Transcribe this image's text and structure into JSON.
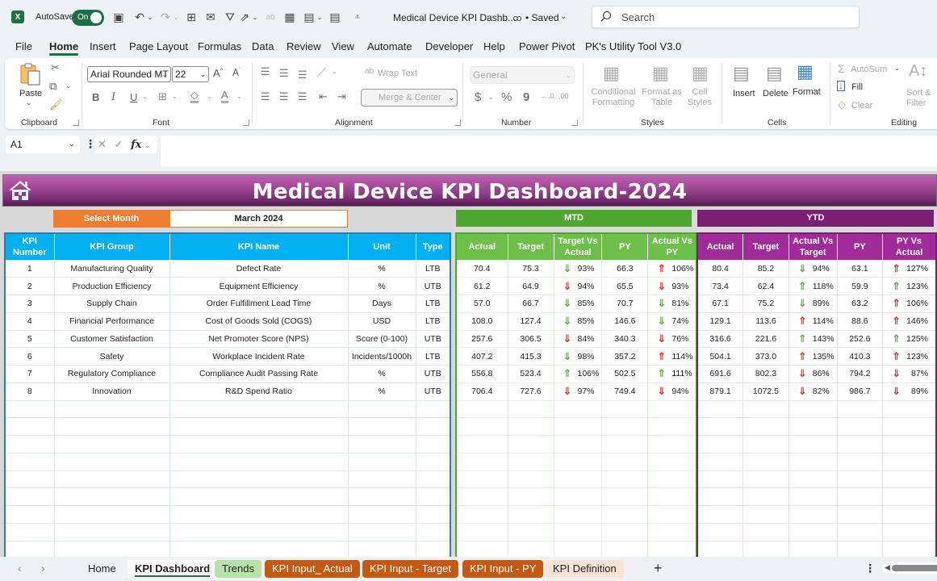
{
  "titlebar": {
    "autosave_label": "AutoSave",
    "autosave_state": "On",
    "document_title": "Medical Device KPI Dashb...",
    "save_status": "• Saved",
    "search_placeholder": "Search"
  },
  "menu": {
    "tabs": [
      "File",
      "Home",
      "Insert",
      "Page Layout",
      "Formulas",
      "Data",
      "Review",
      "View",
      "Automate",
      "Developer",
      "Help",
      "Power Pivot",
      "PK's Utility Tool V3.0"
    ],
    "active": "Home"
  },
  "ribbon": {
    "clipboard": {
      "label": "Clipboard",
      "paste": "Paste"
    },
    "font": {
      "label": "Font",
      "font_name": "Arial Rounded MT",
      "font_size": "22",
      "bold": "B",
      "italic": "I",
      "underline": "U"
    },
    "alignment": {
      "label": "Alignment",
      "wrap_text": "Wrap Text",
      "merge_center": "Merge & Center"
    },
    "number": {
      "label": "Number",
      "format": "General",
      "currency": "$",
      "percent": "%",
      "comma": "9"
    },
    "styles": {
      "label": "Styles",
      "conditional": "Conditional Formatting",
      "format_table": "Format as Table",
      "cell_styles": "Cell Styles"
    },
    "cells": {
      "label": "Cells",
      "insert": "Insert",
      "delete": "Delete",
      "format": "Format"
    },
    "editing": {
      "label": "Editing",
      "autosum": "AutoSum",
      "fill": "Fill",
      "clear": "Clear",
      "sort_filter": "Sort & Filter"
    }
  },
  "formula_bar": {
    "name_box": "A1",
    "fx": "fx",
    "value": ""
  },
  "dashboard": {
    "title": "Medical Device KPI Dashboard-2024",
    "select_month_label": "Select Month",
    "selected_month": "March 2024",
    "mtd_label": "MTD",
    "ytd_label": "YTD",
    "colors": {
      "banner": "#8d3d85",
      "select": "#ed7d31",
      "kpi_header": "#00b0f0",
      "mtd": "#4ea72e",
      "ytd": "#7b1f75",
      "arrow_good": "#4ea72e",
      "arrow_bad": "#e02020"
    },
    "kpi_headers": [
      "KPI Number",
      "KPI Group",
      "KPI Name",
      "Unit",
      "Type"
    ],
    "mtd_headers": [
      "Actual",
      "Target",
      "Target Vs Actual",
      "PY",
      "Actual Vs PY"
    ],
    "ytd_headers": [
      "Actual",
      "Target",
      "Actual Vs Target",
      "PY",
      "PY Vs Actual"
    ],
    "rows": [
      {
        "num": "1",
        "group": "Manufacturing Quality",
        "name": "Defect Rate",
        "unit": "%",
        "type": "LTB",
        "mtd": {
          "actual": "70.4",
          "target": "75.3",
          "tva": "93%",
          "tva_dir": "down",
          "tva_color": "green",
          "py": "66.3",
          "avp": "106%",
          "avp_dir": "up",
          "avp_color": "red"
        },
        "ytd": {
          "actual": "80.4",
          "target": "85.2",
          "avt": "94%",
          "avt_dir": "down",
          "avt_color": "green",
          "py": "63.1",
          "pva": "127%",
          "pva_dir": "up",
          "pva_color": "red"
        }
      },
      {
        "num": "2",
        "group": "Production Efficiency",
        "name": "Equipment Efficiency",
        "unit": "%",
        "type": "UTB",
        "mtd": {
          "actual": "61.2",
          "target": "64.9",
          "tva": "94%",
          "tva_dir": "down",
          "tva_color": "red",
          "py": "65.5",
          "avp": "93%",
          "avp_dir": "down",
          "avp_color": "red"
        },
        "ytd": {
          "actual": "73.4",
          "target": "62.4",
          "avt": "118%",
          "avt_dir": "up",
          "avt_color": "green",
          "py": "59.9",
          "pva": "123%",
          "pva_dir": "up",
          "pva_color": "green"
        }
      },
      {
        "num": "3",
        "group": "Supply Chain",
        "name": "Order Fulfillment Lead Time",
        "unit": "Days",
        "type": "LTB",
        "mtd": {
          "actual": "57.0",
          "target": "66.7",
          "tva": "85%",
          "tva_dir": "down",
          "tva_color": "green",
          "py": "70.7",
          "avp": "81%",
          "avp_dir": "down",
          "avp_color": "green"
        },
        "ytd": {
          "actual": "67.1",
          "target": "75.2",
          "avt": "89%",
          "avt_dir": "down",
          "avt_color": "green",
          "py": "63.2",
          "pva": "106%",
          "pva_dir": "up",
          "pva_color": "red"
        }
      },
      {
        "num": "4",
        "group": "Financial Performance",
        "name": "Cost of Goods Sold (COGS)",
        "unit": "USD",
        "type": "LTB",
        "mtd": {
          "actual": "108.0",
          "target": "127.4",
          "tva": "85%",
          "tva_dir": "down",
          "tva_color": "green",
          "py": "146.6",
          "avp": "74%",
          "avp_dir": "down",
          "avp_color": "green"
        },
        "ytd": {
          "actual": "129.1",
          "target": "113.6",
          "avt": "114%",
          "avt_dir": "up",
          "avt_color": "red",
          "py": "88.6",
          "pva": "146%",
          "pva_dir": "up",
          "pva_color": "red"
        }
      },
      {
        "num": "5",
        "group": "Customer Satisfaction",
        "name": "Net Promoter Score (NPS)",
        "unit": "Score (0-100)",
        "type": "UTB",
        "mtd": {
          "actual": "257.6",
          "target": "306.5",
          "tva": "84%",
          "tva_dir": "down",
          "tva_color": "red",
          "py": "340.3",
          "avp": "76%",
          "avp_dir": "down",
          "avp_color": "red"
        },
        "ytd": {
          "actual": "316.6",
          "target": "221.6",
          "avt": "143%",
          "avt_dir": "up",
          "avt_color": "green",
          "py": "252.6",
          "pva": "125%",
          "pva_dir": "up",
          "pva_color": "green"
        }
      },
      {
        "num": "6",
        "group": "Safety",
        "name": "Workplace Incident Rate",
        "unit": "Incidents/1000h",
        "type": "LTB",
        "mtd": {
          "actual": "407.2",
          "target": "415.3",
          "tva": "98%",
          "tva_dir": "down",
          "tva_color": "green",
          "py": "357.2",
          "avp": "114%",
          "avp_dir": "up",
          "avp_color": "red"
        },
        "ytd": {
          "actual": "504.1",
          "target": "373.0",
          "avt": "135%",
          "avt_dir": "up",
          "avt_color": "red",
          "py": "410.3",
          "pva": "123%",
          "pva_dir": "up",
          "pva_color": "red"
        }
      },
      {
        "num": "7",
        "group": "Regulatory Compliance",
        "name": "Compliance Audit Passing Rate",
        "unit": "%",
        "type": "UTB",
        "mtd": {
          "actual": "556.8",
          "target": "523.4",
          "tva": "106%",
          "tva_dir": "up",
          "tva_color": "green",
          "py": "502.5",
          "avp": "111%",
          "avp_dir": "up",
          "avp_color": "green"
        },
        "ytd": {
          "actual": "691.6",
          "target": "802.3",
          "avt": "86%",
          "avt_dir": "down",
          "avt_color": "red",
          "py": "794.2",
          "pva": "87%",
          "pva_dir": "down",
          "pva_color": "red"
        }
      },
      {
        "num": "8",
        "group": "Innovation",
        "name": "R&D Spend Ratio",
        "unit": "%",
        "type": "UTB",
        "mtd": {
          "actual": "706.4",
          "target": "727.6",
          "tva": "97%",
          "tva_dir": "down",
          "tva_color": "red",
          "py": "749.4",
          "avp": "94%",
          "avp_dir": "down",
          "avp_color": "red"
        },
        "ytd": {
          "actual": "879.1",
          "target": "1072.5",
          "avt": "82%",
          "avt_dir": "down",
          "avt_color": "red",
          "py": "986.7",
          "pva": "89%",
          "pva_dir": "down",
          "pva_color": "red"
        }
      }
    ]
  },
  "sheet_tabs": [
    {
      "label": "Home",
      "bg": "",
      "fg": "#222222"
    },
    {
      "label": "KPI Dashboard",
      "bg": "#ffffff",
      "fg": "#222222",
      "active": true
    },
    {
      "label": "Trends",
      "bg": "#b7e3a8",
      "fg": "#222222"
    },
    {
      "label": "KPI Input_ Actual",
      "bg": "#c45911",
      "fg": "#ffffff"
    },
    {
      "label": "KPI Input - Target",
      "bg": "#c45911",
      "fg": "#ffffff"
    },
    {
      "label": "KPI Input - PY",
      "bg": "#c45911",
      "fg": "#ffffff"
    },
    {
      "label": "KPI Definition",
      "bg": "#fbe2d5",
      "fg": "#222222"
    }
  ]
}
